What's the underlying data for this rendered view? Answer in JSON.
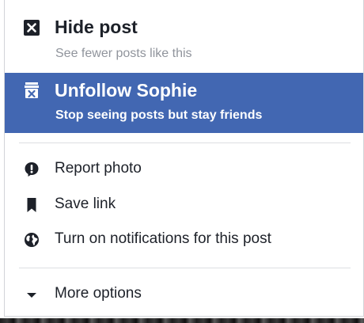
{
  "menu": {
    "hide_post": {
      "title": "Hide post",
      "subtitle": "See fewer posts like this",
      "icon": "close-square-icon"
    },
    "unfollow": {
      "title": "Unfollow Sophie",
      "subtitle": "Stop seeing posts but stay friends",
      "icon": "unfollow-icon",
      "highlighted": true
    },
    "report_photo": {
      "label": "Report photo",
      "icon": "report-icon"
    },
    "save_link": {
      "label": "Save link",
      "icon": "bookmark-icon"
    },
    "notifications": {
      "label": "Turn on notifications for this post",
      "icon": "globe-icon"
    },
    "more_options": {
      "label": "More options",
      "icon": "caret-down-icon"
    }
  },
  "colors": {
    "highlight": "#4267b2",
    "text": "#1d2129",
    "subtext": "#90949c",
    "divider": "#dddfe2"
  }
}
